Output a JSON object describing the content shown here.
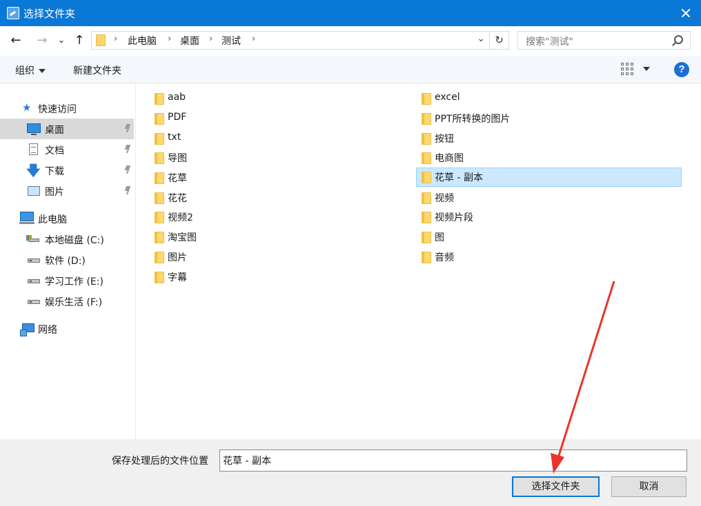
{
  "window": {
    "title": "选择文件夹",
    "close_icon": "close-icon"
  },
  "nav": {
    "back": "←",
    "forward": "→",
    "recent": "⌄",
    "up": "↑"
  },
  "address": {
    "crumbs": [
      "此电脑",
      "桌面",
      "测试"
    ],
    "dropdown": "⌄",
    "refresh": "↻"
  },
  "search": {
    "placeholder": "搜索\"测试\""
  },
  "toolbar": {
    "organize_label": "组织",
    "new_folder_label": "新建文件夹",
    "help": "?"
  },
  "sidebar": {
    "quick_access": "快速访问",
    "items": [
      {
        "label": "桌面",
        "icon": "desktop-icon",
        "pinned": true,
        "selected": true
      },
      {
        "label": "文档",
        "icon": "document-icon",
        "pinned": true
      },
      {
        "label": "下载",
        "icon": "download-icon",
        "pinned": true
      },
      {
        "label": "图片",
        "icon": "pictures-icon",
        "pinned": true
      }
    ],
    "this_pc": "此电脑",
    "drives": [
      "本地磁盘 (C:)",
      "软件 (D:)",
      "学习工作 (E:)",
      "娱乐生活 (F:)"
    ],
    "network": "网络"
  },
  "files": {
    "col1": [
      "aab",
      "PDF",
      "txt",
      "导图",
      "花草",
      "花花",
      "视频2",
      "淘宝图",
      "图片",
      "字幕"
    ],
    "col2": [
      "excel",
      "PPT所转换的图片",
      "按钮",
      "电商图",
      "花草 - 副本",
      "视频",
      "视频片段",
      "图",
      "音频"
    ],
    "selected": "花草 - 副本"
  },
  "footer": {
    "location_label": "保存处理后的文件位置",
    "location_value": "花草 - 副本",
    "select_button": "选择文件夹",
    "cancel_button": "取消"
  },
  "colors": {
    "title_bar": "#0a78d7",
    "selection": "#cce8ff",
    "annotation_arrow": "#e8352b"
  }
}
